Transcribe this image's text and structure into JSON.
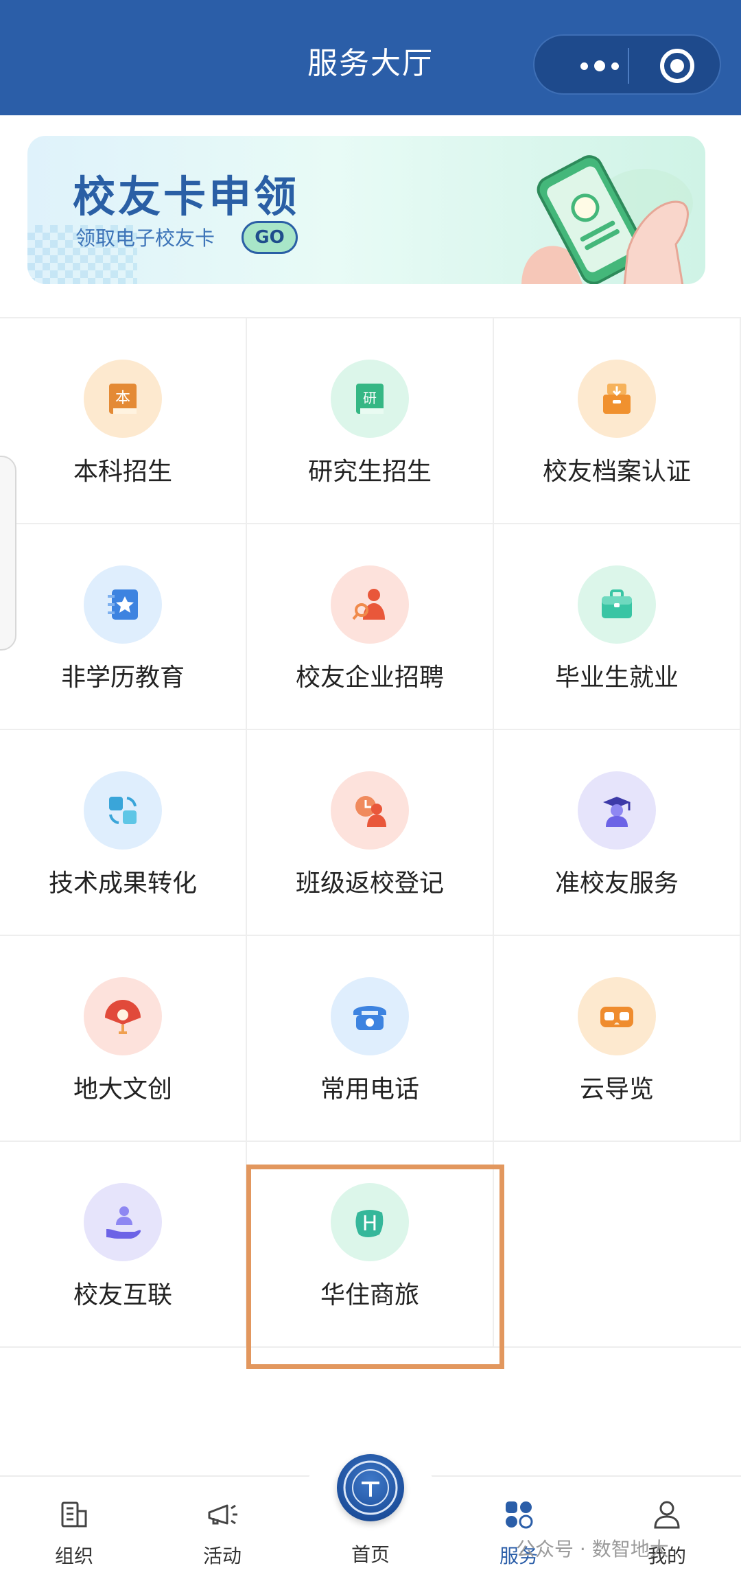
{
  "header": {
    "title": "服务大厅"
  },
  "banner": {
    "title": "校友卡申领",
    "subtitle": "领取电子校友卡",
    "cta": "GO"
  },
  "services": [
    {
      "label": "本科招生",
      "icon": "book-icon",
      "bg": "#fde9cf",
      "fg": "#e48a35"
    },
    {
      "label": "研究生招生",
      "icon": "book-research-icon",
      "bg": "#dcf6ea",
      "fg": "#35b784"
    },
    {
      "label": "校友档案认证",
      "icon": "archive-box-icon",
      "bg": "#fde9cf",
      "fg": "#f0912f"
    },
    {
      "label": "非学历教育",
      "icon": "star-notebook-icon",
      "bg": "#dfeefd",
      "fg": "#3d83e0"
    },
    {
      "label": "校友企业招聘",
      "icon": "recruit-person-icon",
      "bg": "#fde2dc",
      "fg": "#e9573a"
    },
    {
      "label": "毕业生就业",
      "icon": "briefcase-icon",
      "bg": "#dcf6ea",
      "fg": "#39c5a4"
    },
    {
      "label": "技术成果转化",
      "icon": "transform-icon",
      "bg": "#dfeefd",
      "fg": "#3aa5d9"
    },
    {
      "label": "班级返校登记",
      "icon": "clock-person-icon",
      "bg": "#fde2dc",
      "fg": "#e9573a"
    },
    {
      "label": "准校友服务",
      "icon": "graduate-icon",
      "bg": "#e6e4fb",
      "fg": "#6c63e6"
    },
    {
      "label": "地大文创",
      "icon": "fan-icon",
      "bg": "#fde2dc",
      "fg": "#e14a3a"
    },
    {
      "label": "常用电话",
      "icon": "telephone-icon",
      "bg": "#dfeefd",
      "fg": "#3d83e0"
    },
    {
      "label": "云导览",
      "icon": "vr-glasses-icon",
      "bg": "#fde9cf",
      "fg": "#ef8c2e"
    },
    {
      "label": "校友互联",
      "icon": "hand-person-icon",
      "bg": "#e6e4fb",
      "fg": "#6c63e6"
    },
    {
      "label": "华住商旅",
      "icon": "huazhu-h-icon",
      "bg": "#dcf6ea",
      "fg": "#35b79a"
    }
  ],
  "tabbar": {
    "tabs": [
      {
        "label": "组织",
        "icon": "organization-icon"
      },
      {
        "label": "活动",
        "icon": "megaphone-icon"
      },
      {
        "label": "首页",
        "icon": "university-logo-icon"
      },
      {
        "label": "服务",
        "icon": "grid-apps-icon",
        "active": true,
        "color": "#2b5ea8"
      },
      {
        "label": "我的",
        "icon": "user-icon"
      }
    ]
  },
  "watermark": "公众号 · 数智地大"
}
